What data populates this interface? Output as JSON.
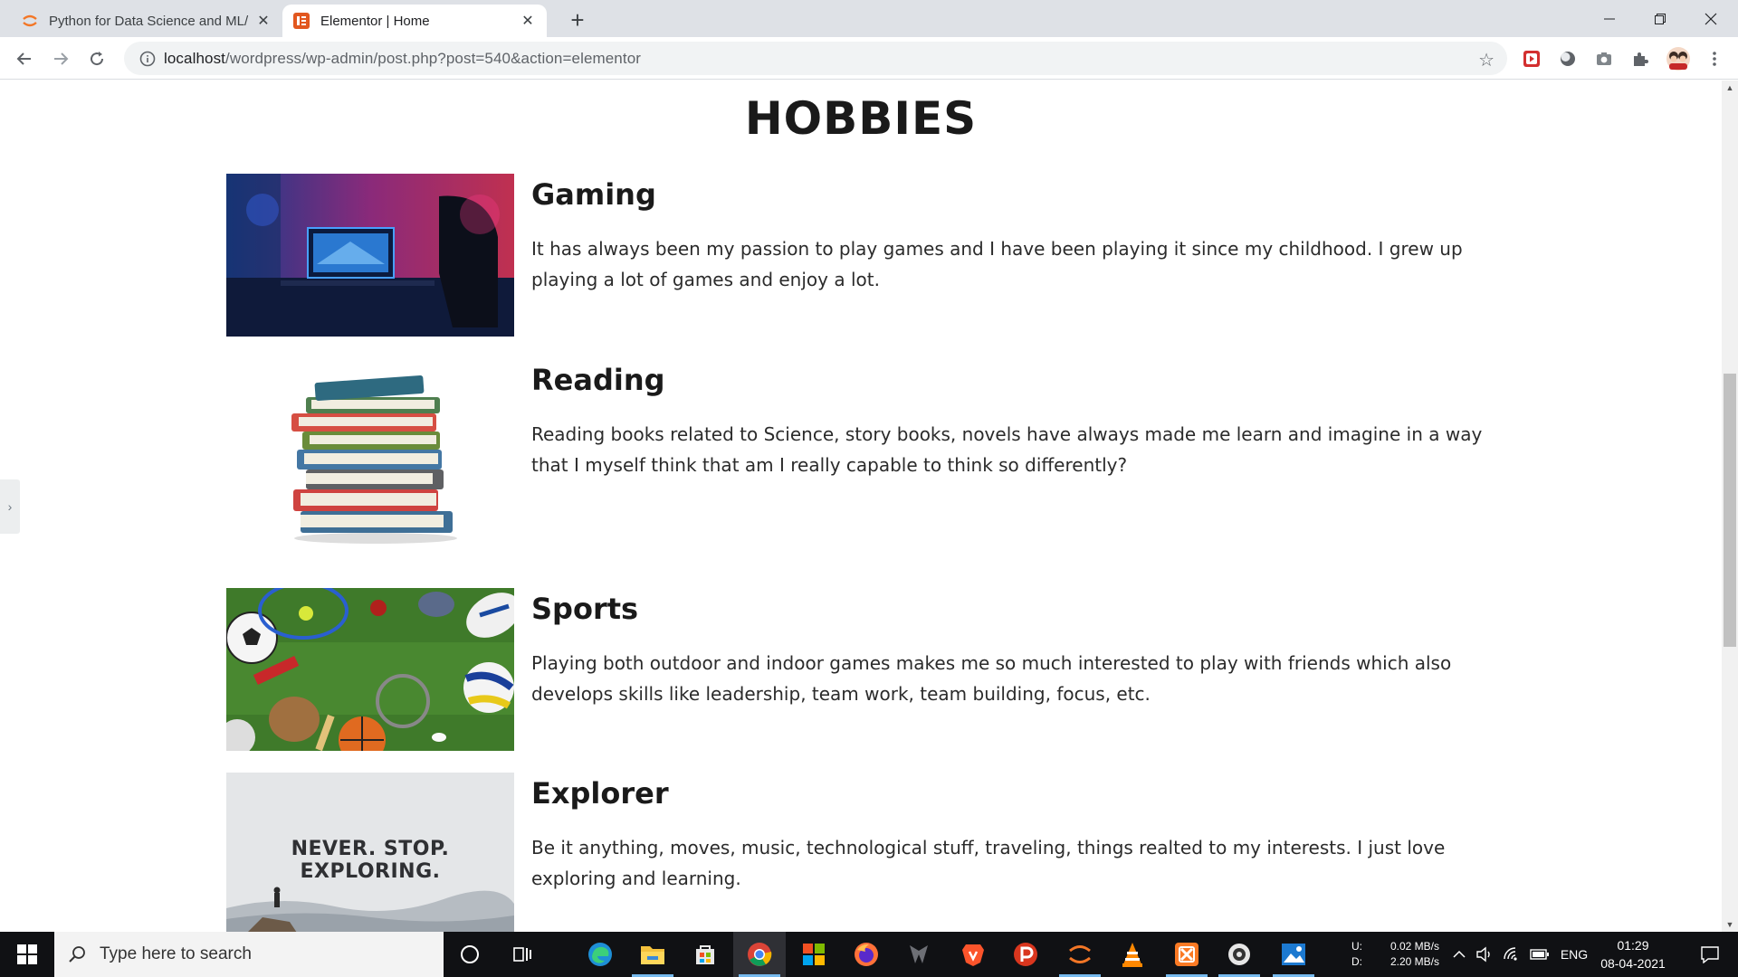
{
  "browser": {
    "tabs": [
      {
        "title": "Python for Data Science and ML/",
        "icon": "jupyter-icon"
      },
      {
        "title": "Elementor | Home",
        "icon": "elementor-icon"
      }
    ],
    "url_host": "localhost",
    "url_path": "/wordpress/wp-admin/post.php?post=540&action=elementor"
  },
  "page": {
    "heading": "HOBBIES",
    "hobbies": [
      {
        "title": "Gaming",
        "description": "It has always been my passion to play games and I have been playing it since my childhood. I grew up playing a lot of games and enjoy a lot."
      },
      {
        "title": "Reading",
        "description": "Reading books related to Science, story books, novels have always made me learn and imagine in a way that I myself think that am I really capable to think so differently?"
      },
      {
        "title": "Sports",
        "description": "Playing both outdoor and indoor games makes me so much interested to play with friends which also develops skills like leadership, team work, team building, focus, etc."
      },
      {
        "title": "Explorer",
        "description": "Be it anything, moves, music, technological stuff, traveling, things realted to my interests. I just love exploring and learning."
      }
    ],
    "explorer_image_text": "NEVER. STOP. EXPLORING."
  },
  "taskbar": {
    "search_placeholder": "Type here to search",
    "net_upload_label": "U:",
    "net_download_label": "D:",
    "net_upload": "0.02 MB/s",
    "net_download": "2.20 MB/s",
    "language": "ENG",
    "time": "01:29",
    "date": "08-04-2021"
  },
  "colors": {
    "tabstrip": "#dee1e6",
    "taskbar": "#101114",
    "accent_blue": "#0078d7"
  }
}
